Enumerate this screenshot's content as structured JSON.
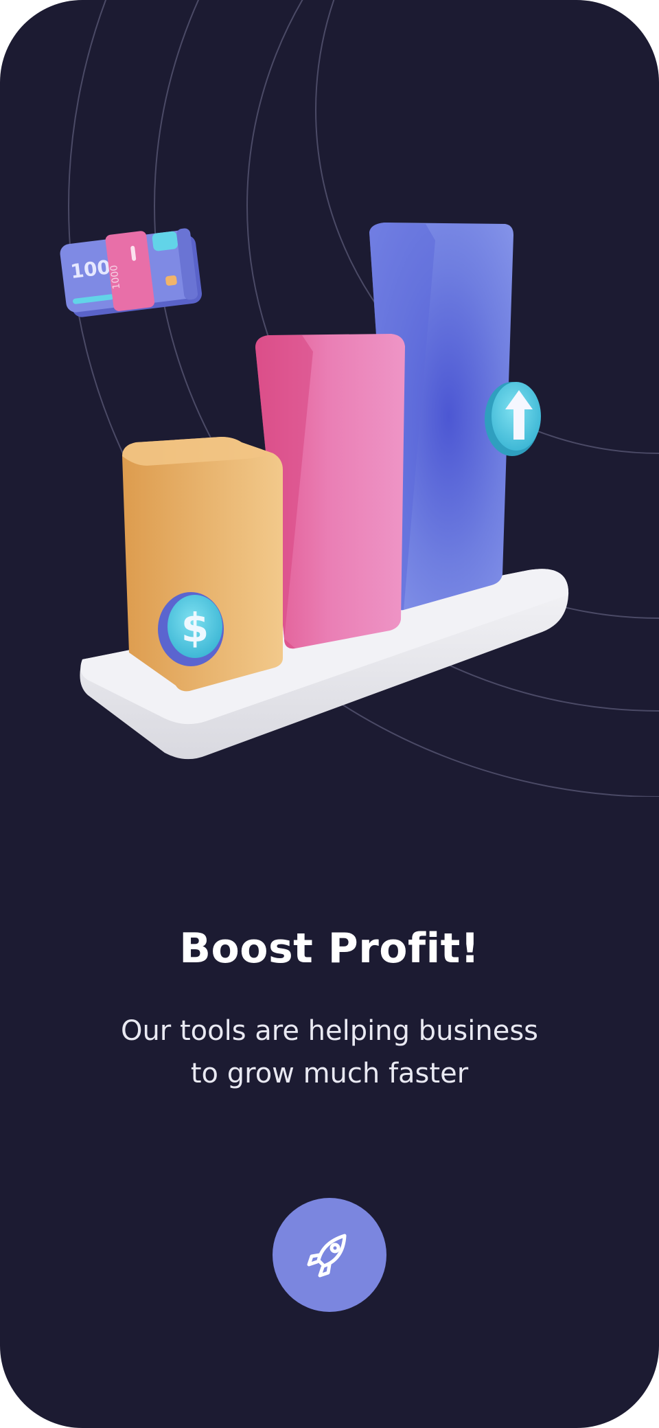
{
  "onboarding": {
    "title": "Boost Profit!",
    "subtitle_line1": "Our tools are helping business",
    "subtitle_line2": "to grow much faster",
    "cta_icon": "rocket-icon"
  },
  "illustration": {
    "banknote_large_label": "100",
    "banknote_small_label": "1000",
    "coin_symbol": "$",
    "arrow_badge_icon": "arrow-up-icon"
  },
  "colors": {
    "background": "#1c1b32",
    "accent": "#7b86df",
    "bar_orange": "#eeb46a",
    "bar_pink": "#ea78b2",
    "bar_blue": "#6f7ee0",
    "badge_cyan": "#4cc6df"
  }
}
